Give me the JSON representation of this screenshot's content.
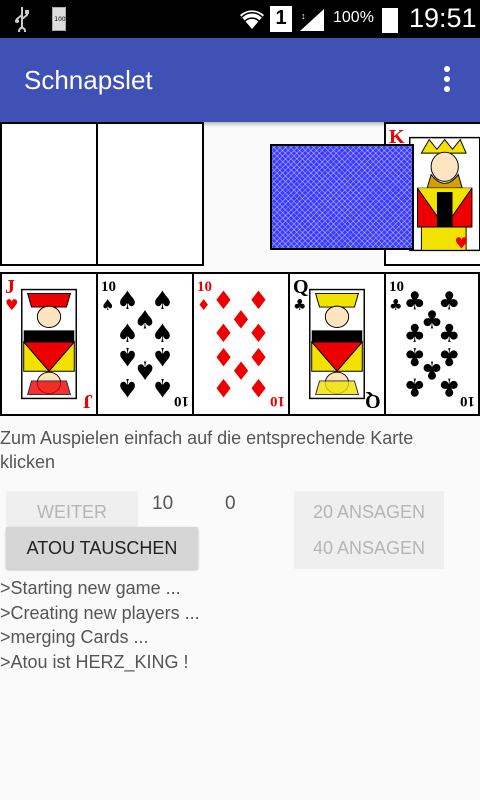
{
  "status_bar": {
    "battery_percent": "100%",
    "time": "19:51",
    "small_battery_label": "100",
    "sim_label": "1"
  },
  "app": {
    "title": "Schnapslet"
  },
  "opponent_cards": [
    "hidden",
    "hidden"
  ],
  "trump_card": {
    "rank": "K",
    "suit": "hearts"
  },
  "hand": [
    {
      "rank": "J",
      "suit": "hearts",
      "color": "red"
    },
    {
      "rank": "10",
      "suit": "spades",
      "color": "black"
    },
    {
      "rank": "10",
      "suit": "diamonds",
      "color": "red"
    },
    {
      "rank": "Q",
      "suit": "clubs",
      "color": "black"
    },
    {
      "rank": "10",
      "suit": "clubs",
      "color": "black"
    }
  ],
  "hint": "Zum Auspielen einfach auf die entsprechende Karte klicken",
  "buttons": {
    "weiter": "WEITER",
    "atou_tauschen": "ATOU TAUSCHEN",
    "ansagen_20": "20 ANSAGEN",
    "ansagen_40": "40 ANSAGEN"
  },
  "scores": {
    "player": "10",
    "computer": "0"
  },
  "log": [
    ">Starting new game ...",
    ">Creating new players ...",
    ">merging Cards ...",
    ">Atou ist HERZ_KING !"
  ]
}
